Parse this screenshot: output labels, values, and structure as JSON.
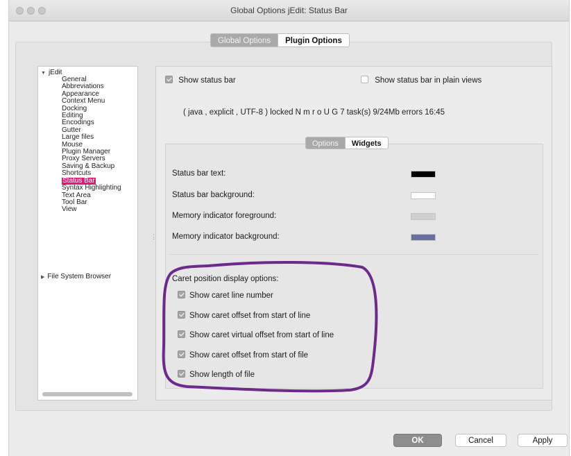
{
  "window": {
    "title": "Global Options jEdit: Status Bar"
  },
  "top_tabs": [
    {
      "label": "Global Options"
    },
    {
      "label": "Plugin Options"
    }
  ],
  "tree": {
    "root": "jEdit",
    "items": [
      "General",
      "Abbreviations",
      "Appearance",
      "Context Menu",
      "Docking",
      "Editing",
      "Encodings",
      "Gutter",
      "Large files",
      "Mouse",
      "Plugin Manager",
      "Proxy Servers",
      "Saving & Backup",
      "Shortcuts",
      "Status Bar",
      "Syntax Highlighting",
      "Text Area",
      "Tool Bar",
      "View"
    ],
    "selected_index": 14,
    "second_root": "File System Browser"
  },
  "status_bar": {
    "show_label": "Show status bar",
    "show_checked": true,
    "plain_label": "Show status bar in plain views",
    "plain_checked": false,
    "preview": "( java , explicit , UTF-8 ) locked N m r o U G 7 task(s) 9/24Mb errors 16:45"
  },
  "sub_tabs": [
    {
      "label": "Options"
    },
    {
      "label": "Widgets"
    }
  ],
  "colors": [
    {
      "label": "Status bar text:",
      "color": "#000000"
    },
    {
      "label": "Status bar background:",
      "color": "#ffffff"
    },
    {
      "label": "Memory indicator foreground:",
      "color": "#d0d0d0"
    },
    {
      "label": "Memory indicator background:",
      "color": "#6b6f9e"
    }
  ],
  "caret": {
    "title": "Caret position display options:",
    "options": [
      {
        "label": "Show caret line number",
        "checked": true
      },
      {
        "label": "Show caret offset from start of line",
        "checked": true
      },
      {
        "label": "Show caret virtual offset from start of line",
        "checked": true
      },
      {
        "label": "Show caret offset from start of file",
        "checked": true
      },
      {
        "label": "Show length of file",
        "checked": true
      }
    ]
  },
  "buttons": {
    "ok": "OK",
    "cancel": "Cancel",
    "apply": "Apply"
  },
  "annotation_color": "#6b2a8c"
}
